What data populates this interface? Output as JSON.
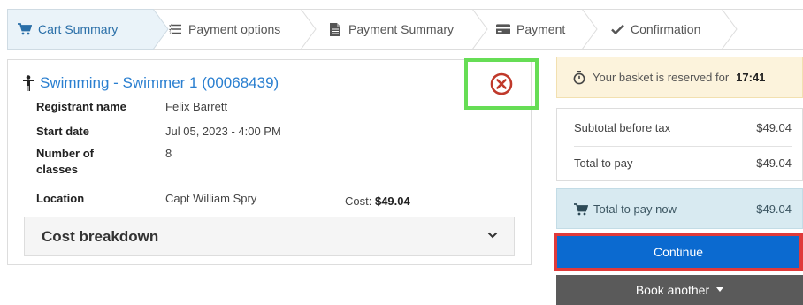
{
  "steps": [
    {
      "label": "Cart Summary",
      "icon": "cart-icon",
      "active": true
    },
    {
      "label": "Payment options",
      "icon": "list-icon",
      "active": false
    },
    {
      "label": "Payment Summary",
      "icon": "document-icon",
      "active": false
    },
    {
      "label": "Payment",
      "icon": "credit-card-icon",
      "active": false
    },
    {
      "label": "Confirmation",
      "icon": "check-icon",
      "active": false
    }
  ],
  "item": {
    "title": "Swimming - Swimmer 1 (00068439)",
    "icon": "swimmer-icon",
    "remove_icon": "remove-circle-icon",
    "details": [
      {
        "label": "Registrant name",
        "value": "Felix Barrett"
      },
      {
        "label": "Start date",
        "value": "Jul 05, 2023 - 4:00 PM"
      },
      {
        "label": "Number of classes",
        "value": "8"
      },
      {
        "label": "Location",
        "value": "Capt William Spry"
      }
    ],
    "cost_label": "Cost:",
    "cost_value": "$49.04",
    "breakdown_label": "Cost breakdown"
  },
  "summary": {
    "reserve_text": "Your basket is reserved for",
    "reserve_time": "17:41",
    "subtotal_label": "Subtotal before tax",
    "subtotal_value": "$49.04",
    "total_label": "Total to pay",
    "total_value": "$49.04",
    "pay_now_label": "Total to pay now",
    "pay_now_value": "$49.04",
    "continue_label": "Continue",
    "book_another_label": "Book another"
  },
  "colors": {
    "accent_blue": "#0b6ad0",
    "link_blue": "#2a7fd0",
    "remove_red": "#c0392b",
    "highlight_green": "#66dd55",
    "highlight_red": "#e03a3a"
  }
}
